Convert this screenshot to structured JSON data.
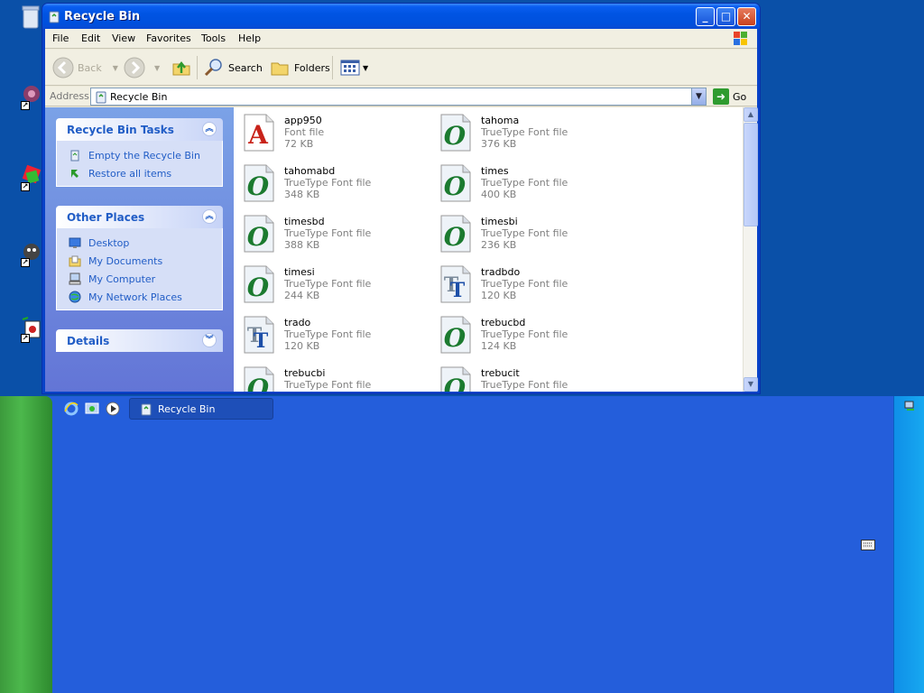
{
  "window": {
    "title": "Recycle Bin",
    "title_icon": "recycle-bin-icon"
  },
  "menu": [
    "File",
    "Edit",
    "View",
    "Favorites",
    "Tools",
    "Help"
  ],
  "toolbar": {
    "back_label": "Back",
    "search_label": "Search",
    "folders_label": "Folders"
  },
  "address": {
    "label": "Address",
    "value": "Recycle Bin",
    "go_label": "Go"
  },
  "tasks_panel": {
    "title": "Recycle Bin Tasks",
    "items": [
      "Empty the Recycle Bin",
      "Restore all items"
    ]
  },
  "places_panel": {
    "title": "Other Places",
    "items": [
      "Desktop",
      "My Documents",
      "My Computer",
      "My Network Places"
    ]
  },
  "details_panel": {
    "title": "Details"
  },
  "files": [
    {
      "name": "app950",
      "type": "Font file",
      "size": "72 KB",
      "icon": "font-file-icon"
    },
    {
      "name": "tahoma",
      "type": "TrueType Font file",
      "size": "376 KB",
      "icon": "opentype-font-icon"
    },
    {
      "name": "tahomabd",
      "type": "TrueType Font file",
      "size": "348 KB",
      "icon": "opentype-font-icon"
    },
    {
      "name": "times",
      "type": "TrueType Font file",
      "size": "400 KB",
      "icon": "opentype-font-icon"
    },
    {
      "name": "timesbd",
      "type": "TrueType Font file",
      "size": "388 KB",
      "icon": "opentype-font-icon"
    },
    {
      "name": "timesbi",
      "type": "TrueType Font file",
      "size": "236 KB",
      "icon": "opentype-font-icon"
    },
    {
      "name": "timesi",
      "type": "TrueType Font file",
      "size": "244 KB",
      "icon": "opentype-font-icon"
    },
    {
      "name": "tradbdo",
      "type": "TrueType Font file",
      "size": "120 KB",
      "icon": "truetype-font-icon"
    },
    {
      "name": "trado",
      "type": "TrueType Font file",
      "size": "120 KB",
      "icon": "truetype-font-icon"
    },
    {
      "name": "trebucbd",
      "type": "TrueType Font file",
      "size": "124 KB",
      "icon": "opentype-font-icon"
    },
    {
      "name": "trebucbi",
      "type": "TrueType Font file",
      "size": "",
      "icon": "opentype-font-icon"
    },
    {
      "name": "trebucit",
      "type": "TrueType Font file",
      "size": "",
      "icon": "opentype-font-icon"
    }
  ],
  "taskbar": {
    "task_label": "Recycle Bin"
  }
}
